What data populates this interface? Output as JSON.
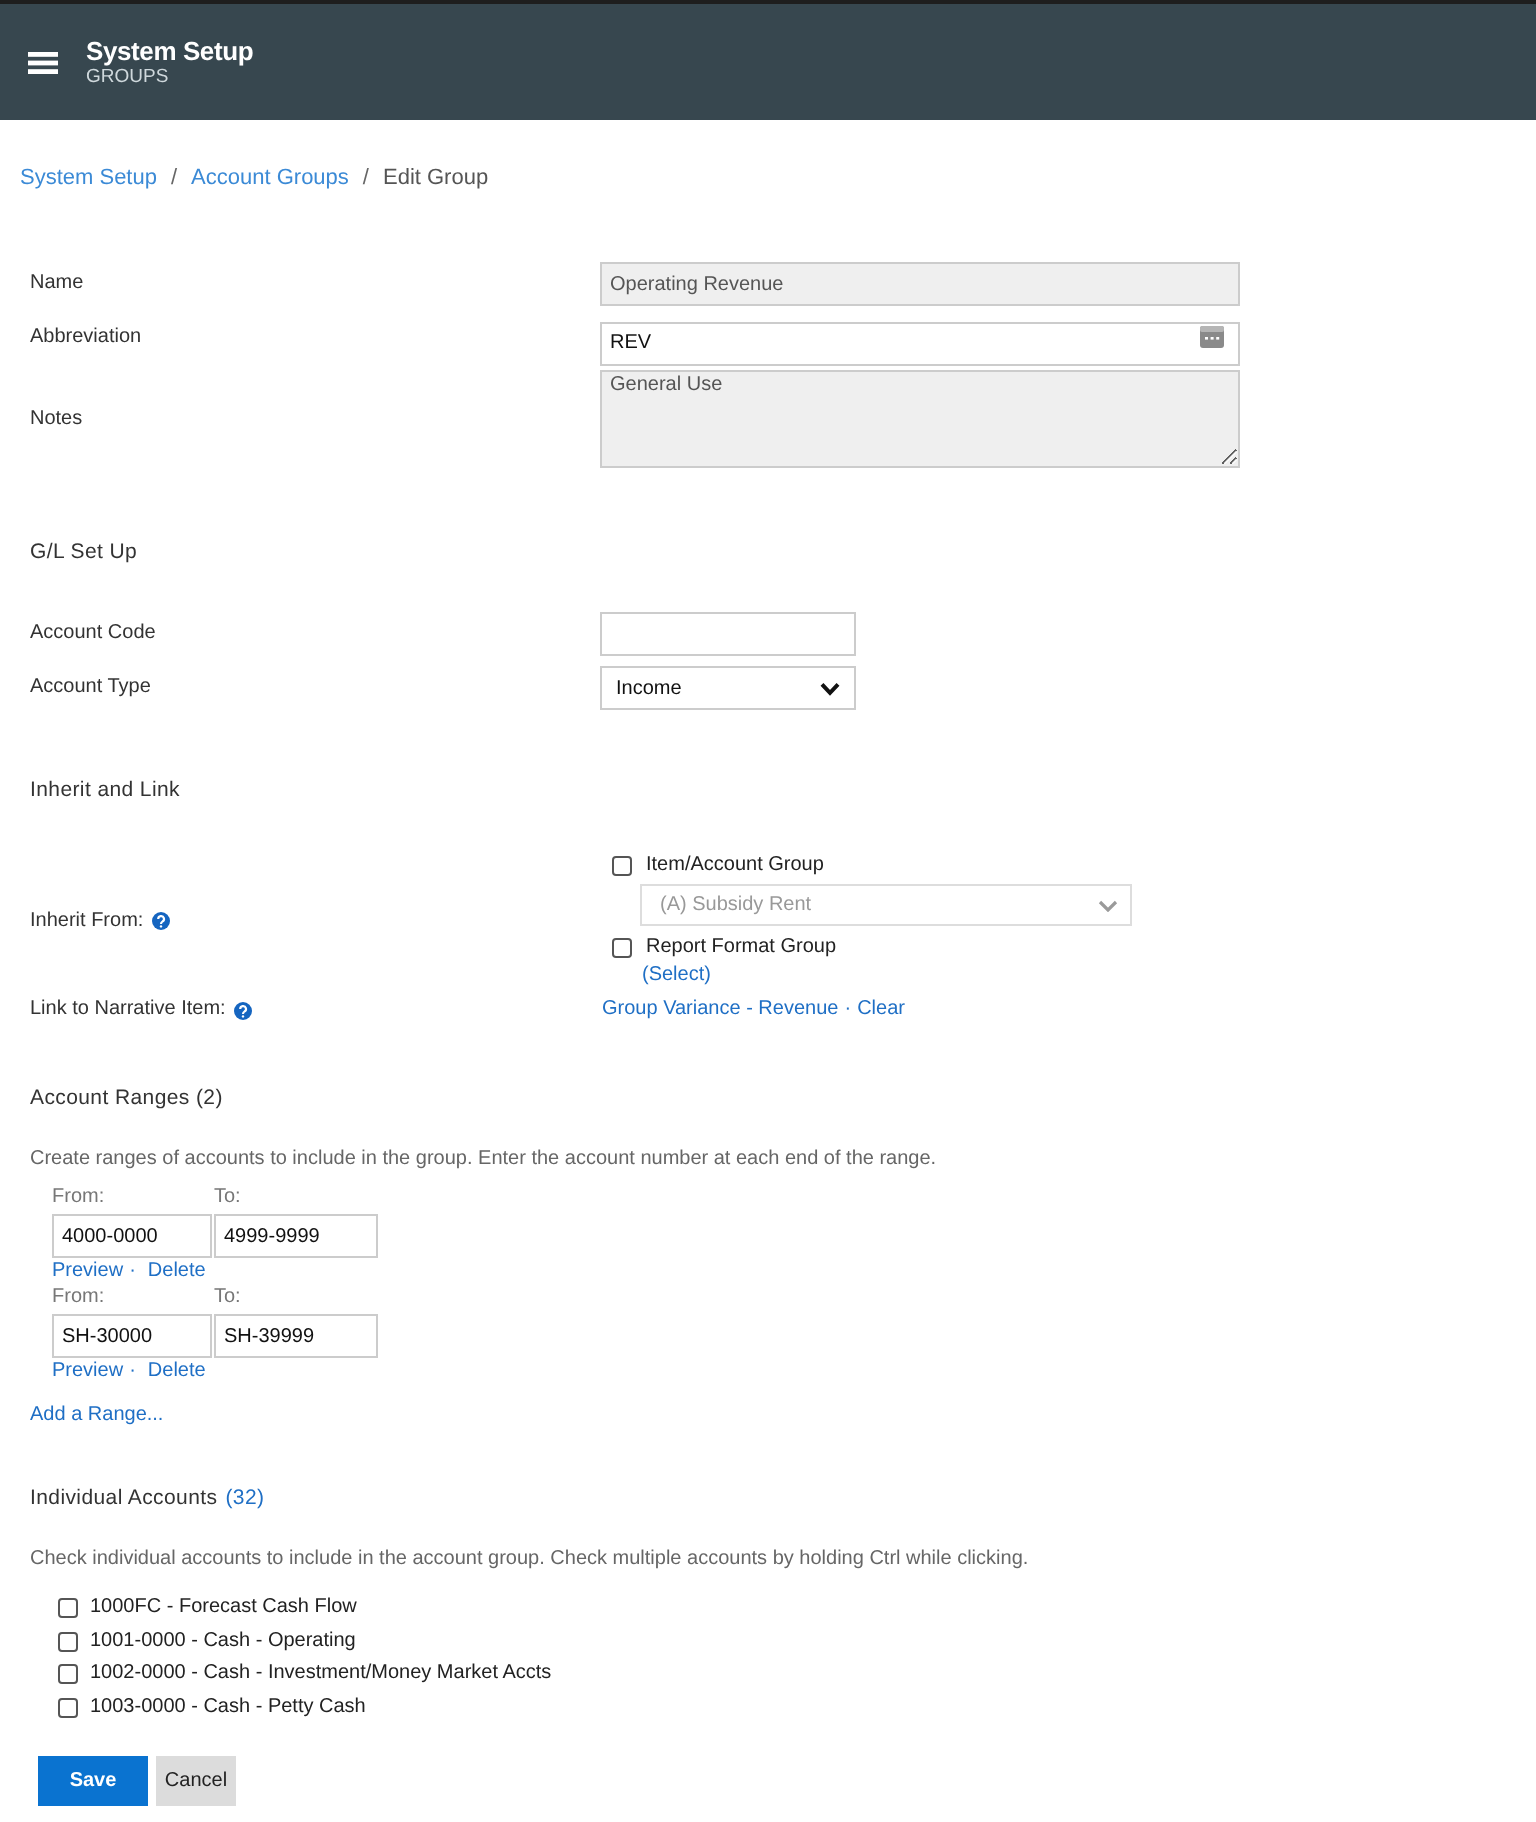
{
  "header": {
    "title": "System Setup",
    "subtitle": "GROUPS"
  },
  "breadcrumb": {
    "separator": "/",
    "items": [
      {
        "label": "System Setup",
        "kind": "link"
      },
      {
        "label": "Account Groups",
        "kind": "link"
      },
      {
        "label": "Edit Group",
        "kind": "current"
      }
    ]
  },
  "general": [
    {
      "label": "Name",
      "kind": "text",
      "value": "Operating Revenue",
      "readonly": true
    },
    {
      "label": "Abbreviation",
      "kind": "text",
      "value": "REV",
      "readonly": false
    },
    {
      "label": "Notes",
      "kind": "textarea",
      "value": "General Use",
      "readonly": true
    }
  ],
  "gl_setup": {
    "heading": "G/L Set Up",
    "fields": [
      {
        "label": "Account Code",
        "kind": "text",
        "readonly": false
      },
      {
        "label": "Account Type",
        "kind": "select",
        "value": "Income"
      }
    ]
  },
  "inherit_and_link": {
    "heading": "Inherit and Link",
    "inherit_from": {
      "label": "Inherit From:",
      "options": [
        {
          "kind": "select",
          "label": "Item/Account Group",
          "checked": false,
          "select": {
            "value": "(A) Subsidy Rent",
            "disabled": true
          }
        },
        {
          "kind": "link",
          "label": "Report Format Group",
          "checked": false,
          "link": "(Select)"
        }
      ]
    },
    "narrative": {
      "label": "Link to Narrative Item:",
      "separator": "·",
      "links": [
        "Group Variance - Revenue",
        "Clear"
      ]
    }
  },
  "account_ranges": {
    "heading": "Account Ranges (2)",
    "description": "Create ranges of accounts to include in the group. Enter the account number at each end of the range.",
    "action_separator": "·",
    "ranges": [
      {
        "from_label": "From:",
        "from": "4000-0000",
        "to_label": "To:",
        "to": "4999-9999",
        "actions": [
          "Preview",
          "Delete"
        ]
      },
      {
        "from_label": "From:",
        "from": "SH-30000",
        "to_label": "To:",
        "to": "SH-39999",
        "actions": [
          "Preview",
          "Delete"
        ]
      }
    ],
    "add_link": "Add a Range..."
  },
  "individual_accounts": {
    "heading": "Individual Accounts",
    "count": "(32)",
    "description": "Check individual accounts to include in the account group. Check multiple accounts by holding Ctrl while clicking.",
    "accounts": [
      {
        "label": "1000FC - Forecast Cash Flow",
        "checked": false
      },
      {
        "label": "1001-0000 - Cash - Operating",
        "checked": false
      },
      {
        "label": "1002-0000 - Cash - Investment/Money Market Accts",
        "checked": false
      },
      {
        "label": "1003-0000 - Cash - Petty Cash",
        "checked": false
      }
    ]
  },
  "buttons": [
    {
      "label": "Save",
      "kind": "primary"
    },
    {
      "label": "Cancel",
      "kind": "secondary"
    }
  ]
}
